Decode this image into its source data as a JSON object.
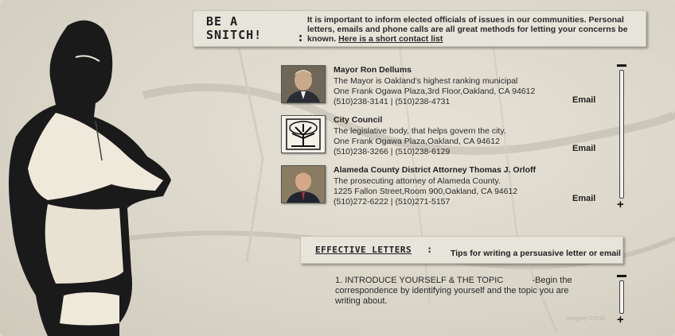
{
  "header": {
    "title_line1": "BE A",
    "title_line2": "SNITCH!",
    "title_colon": ":",
    "intro": "It is important to inform elected officials of issues in our communities.  Personal letters, emails and phone calls are all great methods for letting your concerns be known.",
    "intro_link": "Here is a short contact list"
  },
  "contacts": [
    {
      "name": "Mayor Ron Dellums",
      "description": "The Mayor is Oakland's highest ranking municipal",
      "address": "One Frank Ogawa Plaza,3rd Floor,Oakland, CA 94612",
      "phone": "(510)238-3141 | (510)238-4731",
      "email_label": "Email",
      "photo_icon": "portrait-photo"
    },
    {
      "name": "City Council",
      "description": "The legislative body, that helps govern the city.",
      "address": "One Frank Ogawa Plaza,Oakland, CA 94612",
      "phone": "(510)238-3266 | (510)238-6129",
      "email_label": "Email",
      "photo_icon": "oak-tree-logo"
    },
    {
      "name": "Alameda County District Attorney Thomas J. Orloff",
      "description": "The prosecuting attorney of Alameda County.",
      "address": "1225 Fallon Street,Room 900,Oakland, CA 94612",
      "phone": "(510)272-6222 | (510)271-5157",
      "email_label": "Email",
      "photo_icon": "portrait-photo"
    }
  ],
  "letters": {
    "title": "EFFECTIVE LETTERS",
    "colon": ":",
    "subtitle": "Tips for writing a persuasive letter or email",
    "tip_title": "1. INTRODUCE YOURSELF & THE TOPIC",
    "tip_body": "-Begin the correspondence by identifying yourself and the topic you are writing about."
  },
  "scroll": {
    "minus": "−",
    "plus": "+"
  },
  "footer": {
    "imagery": "Imagery ©2010"
  },
  "colors": {
    "background": "#dcd8cc",
    "panel": "#e7e4da",
    "ink": "#1e1e1e"
  }
}
